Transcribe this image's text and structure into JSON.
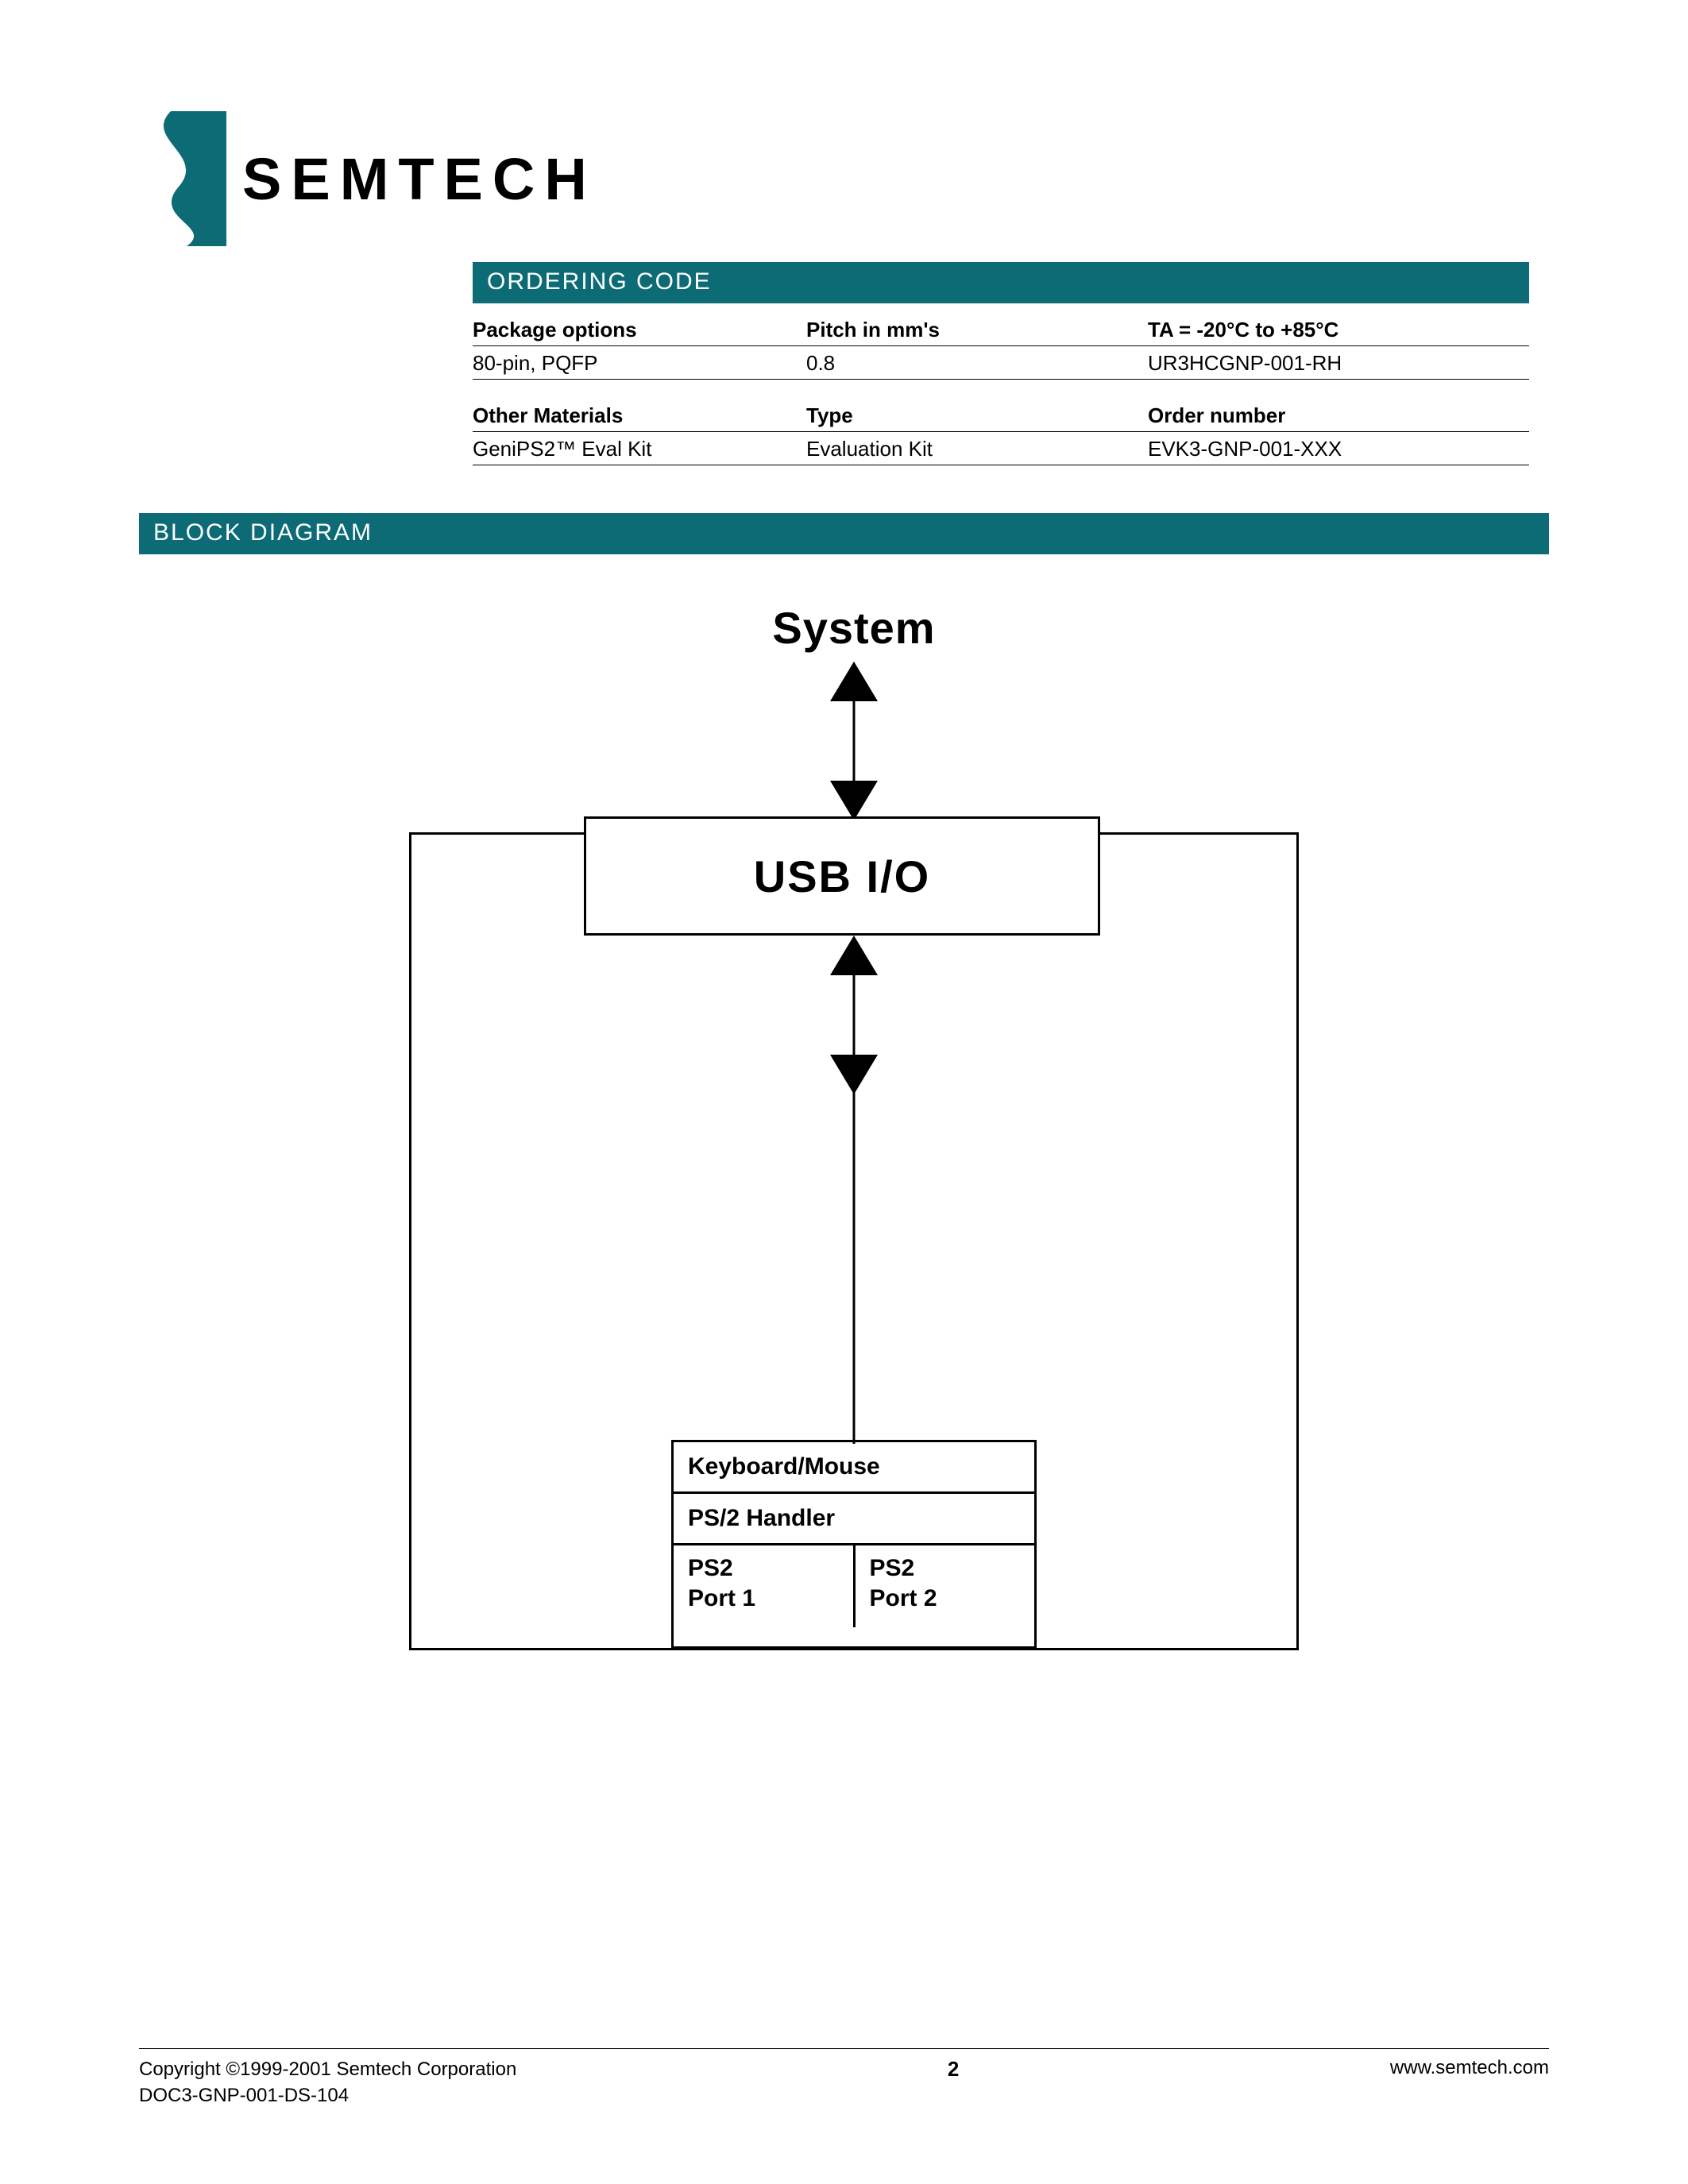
{
  "brand": "SEMTECH",
  "sections": {
    "ordering_title": "ORDERING CODE",
    "block_title": "BLOCK DIAGRAM"
  },
  "ordering": {
    "head1": {
      "c1": "Package options",
      "c2": "Pitch in mm's",
      "c3": "TA = -20°C to +85°C"
    },
    "row1": {
      "c1": "80-pin, PQFP",
      "c2": "0.8",
      "c3": "UR3HCGNP-001-RH"
    },
    "head2": {
      "c1": "Other Materials",
      "c2": "Type",
      "c3": "Order number"
    },
    "row2": {
      "c1": "GeniPS2™ Eval Kit",
      "c2": "Evaluation Kit",
      "c3": "EVK3-GNP-001-XXX"
    }
  },
  "diagram": {
    "system": "System",
    "usb": "USB I/O",
    "kb1": "Keyboard/Mouse",
    "kb2": "PS/2 Handler",
    "port1a": "PS2",
    "port1b": "Port 1",
    "port2a": "PS2",
    "port2b": "Port 2"
  },
  "footer": {
    "copyright": "Copyright ©1999-2001 Semtech Corporation",
    "doc": "DOC3-GNP-001-DS-104",
    "page": "2",
    "url": "www.semtech.com"
  }
}
